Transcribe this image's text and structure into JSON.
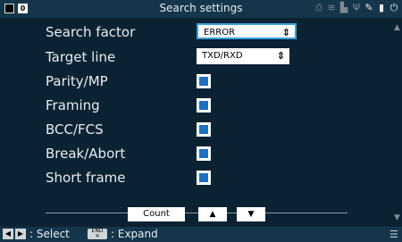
{
  "window": {
    "title": "Search settings",
    "page_indicator": "0"
  },
  "status_icons": [
    "printer-icon",
    "wifi-icon",
    "network-icon",
    "usb-icon",
    "tool-icon",
    "sdcard-icon",
    "battery-plug-icon"
  ],
  "settings": {
    "search_factor": {
      "label": "Search factor",
      "value": "ERROR"
    },
    "target_line": {
      "label": "Target line",
      "value": "TXD/RXD"
    },
    "parity": {
      "label": "Parity/MP",
      "checked": true
    },
    "framing": {
      "label": "Framing",
      "checked": true
    },
    "bcc": {
      "label": "BCC/FCS",
      "checked": true
    },
    "break_abort": {
      "label": "Break/Abort",
      "checked": true
    },
    "short_frame": {
      "label": "Short frame",
      "checked": true
    }
  },
  "buttons": {
    "count": "Count",
    "up": "▲",
    "down": "▼"
  },
  "footer": {
    "select_label": ": Select",
    "end_key": "END",
    "expand_label": ": Expand"
  },
  "colors": {
    "background": "#0b2233",
    "bar": "#15354a",
    "checkbox_fill": "#1f6fbf",
    "focus": "#39a0d8"
  }
}
